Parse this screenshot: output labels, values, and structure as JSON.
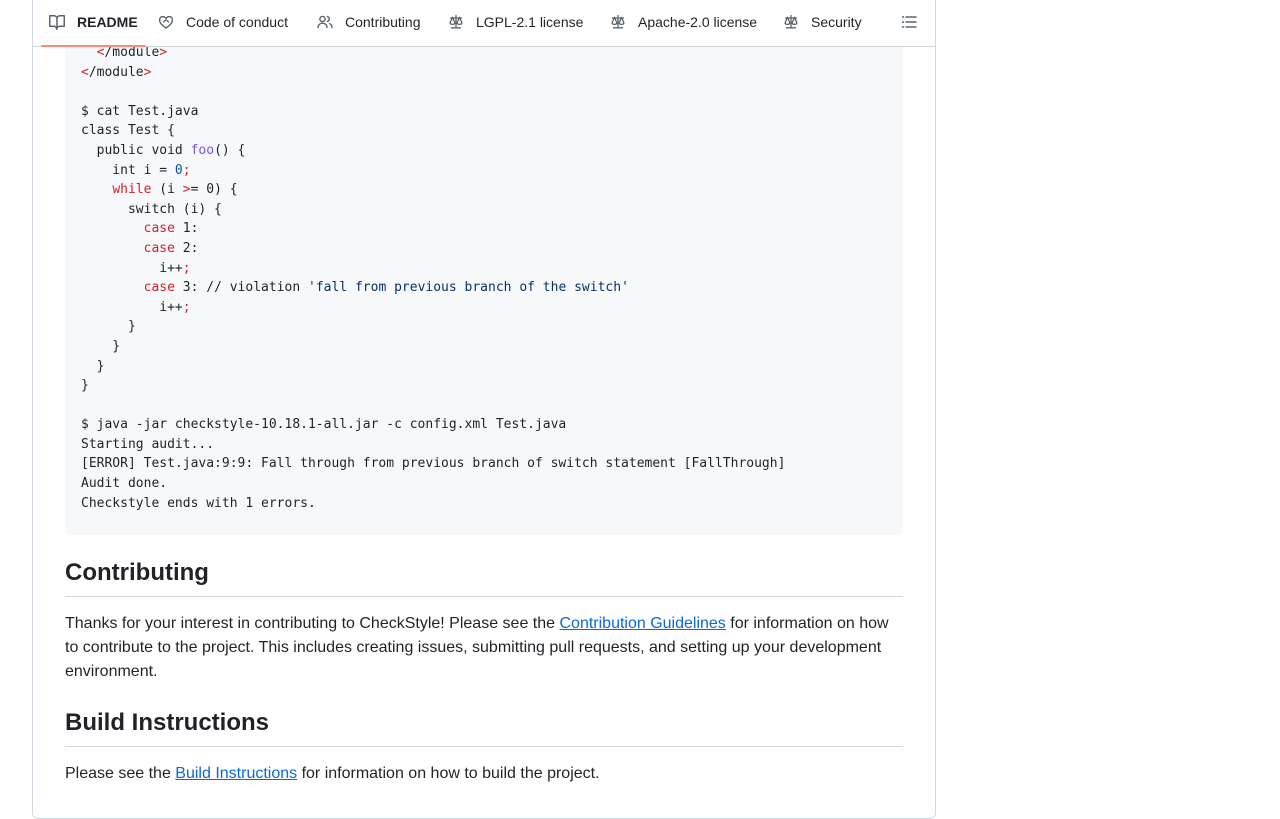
{
  "tabs": [
    {
      "label": "README",
      "icon": "book-icon"
    },
    {
      "label": "Code of conduct",
      "icon": "heart-icon"
    },
    {
      "label": "Contributing",
      "icon": "people-icon"
    },
    {
      "label": "LGPL-2.1 license",
      "icon": "law-icon"
    },
    {
      "label": "Apache-2.0 license",
      "icon": "law-icon"
    },
    {
      "label": "Security",
      "icon": "law-icon"
    }
  ],
  "code_lines": [
    "  </module>",
    "</module>",
    "",
    "$ cat Test.java",
    "class Test {",
    "  public void foo() {",
    "    int i = 0;",
    "    while (i >= 0) {",
    "      switch (i) {",
    "        case 1:",
    "        case 2:",
    "          i++;",
    "        case 3: // violation 'fall from previous branch of the switch'",
    "          i++;",
    "      }",
    "    }",
    "  }",
    "}",
    "",
    "$ java -jar checkstyle-10.18.1-all.jar -c config.xml Test.java",
    "Starting audit...",
    "[ERROR] Test.java:9:9: Fall through from previous branch of switch statement [FallThrough]",
    "Audit done.",
    "Checkstyle ends with 1 errors."
  ],
  "contributing": {
    "heading": "Contributing",
    "text_before": "Thanks for your interest in contributing to CheckStyle! Please see the ",
    "link": "Contribution Guidelines",
    "text_after": " for information on how to contribute to the project. This includes creating issues, submitting pull requests, and setting up your development environment."
  },
  "build": {
    "heading": "Build Instructions",
    "text_before": "Please see the ",
    "link": "Build Instructions",
    "text_after": " for information on how to build the project."
  },
  "colors": {
    "active_tab_underline": "#fd8c73",
    "link": "#0969da",
    "keyword": "#cf222e",
    "function": "#8250df",
    "string": "#0a3069"
  }
}
